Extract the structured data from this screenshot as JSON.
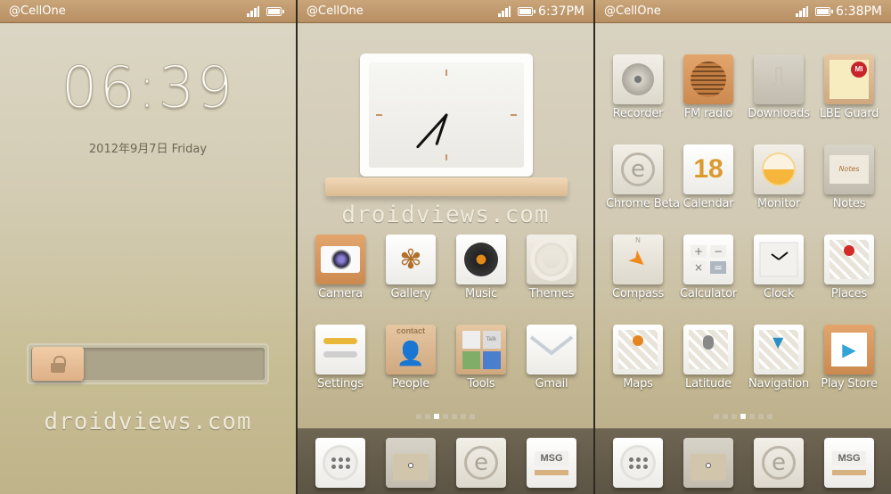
{
  "screens": [
    {
      "name": "lock-screen",
      "status": {
        "carrier": "@CellOne",
        "time": ""
      },
      "clock": "06:39",
      "date": "2012年9月7日 Friday",
      "unlock_slider": {
        "icon": "lock-icon"
      },
      "watermark": "droidviews.com"
    },
    {
      "name": "home-screen",
      "status": {
        "carrier": "@CellOne",
        "time": "6:37PM"
      },
      "widget": {
        "type": "analog-clock",
        "hour": 6,
        "minute": 37
      },
      "watermark": "droidviews.com",
      "apps": [
        {
          "label": "Camera",
          "icon": "camera-icon"
        },
        {
          "label": "Gallery",
          "icon": "leaf-icon"
        },
        {
          "label": "Music",
          "icon": "vinyl-record-icon"
        },
        {
          "label": "Themes",
          "icon": "ripple-icon"
        },
        {
          "label": "Settings",
          "icon": "toggle-sliders-icon"
        },
        {
          "label": "People",
          "icon": "contact-card-icon",
          "badge_text": "contact"
        },
        {
          "label": "Tools",
          "icon": "folder-grid-icon",
          "badge_text": "Talk"
        },
        {
          "label": "Gmail",
          "icon": "envelope-icon"
        }
      ],
      "page_indicator": {
        "count": 7,
        "active": 3
      }
    },
    {
      "name": "apps-screen",
      "status": {
        "carrier": "@CellOne",
        "time": "6:38PM"
      },
      "apps": [
        {
          "label": "Recorder",
          "icon": "recorder-reel-icon"
        },
        {
          "label": "FM radio",
          "icon": "speaker-grille-icon"
        },
        {
          "label": "Downloads",
          "icon": "download-arrow-icon"
        },
        {
          "label": "LBE Guard",
          "icon": "certificate-seal-icon",
          "badge_text": "MI"
        },
        {
          "label": "Chrome Beta",
          "icon": "browser-e-icon"
        },
        {
          "label": "Calendar",
          "icon": "calendar-icon",
          "badge_text": "18"
        },
        {
          "label": "Monitor",
          "icon": "pie-gauge-icon"
        },
        {
          "label": "Notes",
          "icon": "notepad-icon",
          "badge_text": "Notes"
        },
        {
          "label": "Compass",
          "icon": "compass-icon",
          "badge_text": "N"
        },
        {
          "label": "Calculator",
          "icon": "calculator-icon"
        },
        {
          "label": "Clock",
          "icon": "clock-icon"
        },
        {
          "label": "Places",
          "icon": "map-pin-icon"
        },
        {
          "label": "Maps",
          "icon": "map-icon"
        },
        {
          "label": "Latitude",
          "icon": "map-person-icon"
        },
        {
          "label": "Navigation",
          "icon": "map-navigation-icon"
        },
        {
          "label": "Play Store",
          "icon": "shopping-bag-play-icon"
        }
      ],
      "page_indicator": {
        "count": 7,
        "active": 4
      }
    }
  ],
  "dock": [
    {
      "icon": "phone-dialpad-icon"
    },
    {
      "icon": "file-folder-icon"
    },
    {
      "icon": "browser-e-icon"
    },
    {
      "icon": "messaging-icon",
      "badge_text": "MSG"
    }
  ],
  "colors": {
    "status_bar": "#bf9a6c",
    "accent_wood": "#deb088",
    "dot_active": "#ffffff"
  }
}
